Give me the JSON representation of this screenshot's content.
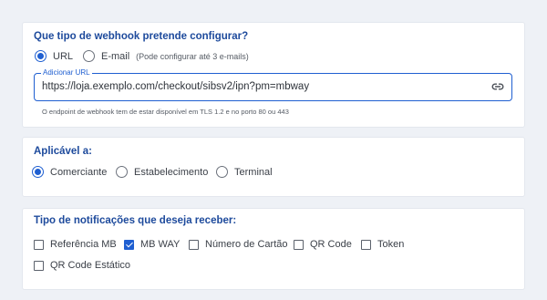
{
  "webhook_type": {
    "heading": "Que tipo de webhook pretende configurar?",
    "options": [
      {
        "label": "URL",
        "selected": true
      },
      {
        "label": "E-mail",
        "hint": "(Pode configurar até 3 e-mails)",
        "selected": false
      }
    ],
    "url_field": {
      "label": "Adicionar URL",
      "value": "https://loja.exemplo.com/checkout/sibsv2/ipn?pm=mbway",
      "icon": "link-icon"
    },
    "helper_text": "O endpoint de webhook tem de estar disponível em TLS 1.2 e no porto 80 ou 443"
  },
  "applicable": {
    "heading": "Aplicável a:",
    "options": [
      {
        "label": "Comerciante",
        "selected": true
      },
      {
        "label": "Estabelecimento",
        "selected": false
      },
      {
        "label": "Terminal",
        "selected": false
      }
    ]
  },
  "notifications": {
    "heading": "Tipo de notificações que deseja receber:",
    "options": [
      {
        "label": "Referência MB",
        "checked": false
      },
      {
        "label": "MB WAY",
        "checked": true
      },
      {
        "label": "Número de Cartão",
        "checked": false
      },
      {
        "label": "QR Code",
        "checked": false
      },
      {
        "label": "Token",
        "checked": false
      },
      {
        "label": "QR Code Estático",
        "checked": false
      }
    ]
  },
  "colors": {
    "accent": "#1f5fd1",
    "heading": "#1d4a9c",
    "background": "#eef1f6"
  }
}
